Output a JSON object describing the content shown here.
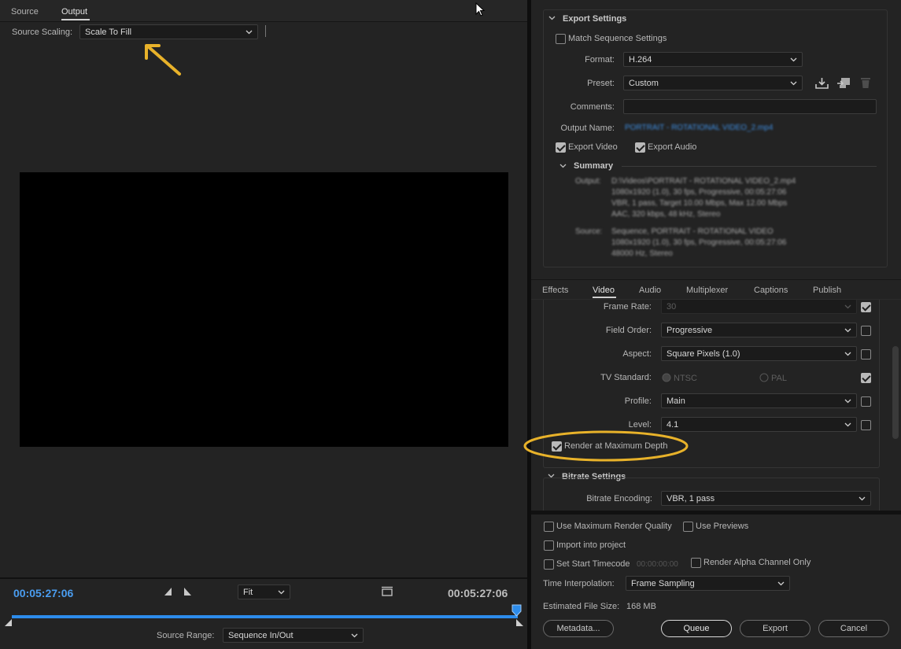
{
  "left": {
    "tabs": [
      {
        "label": "Source"
      },
      {
        "label": "Output"
      }
    ],
    "source_scaling_label": "Source Scaling:",
    "source_scaling_value": "Scale To Fill",
    "timecode_left": "00:05:27:06",
    "timecode_right": "00:05:27:06",
    "zoom_value": "Fit",
    "source_range_label": "Source Range:",
    "source_range_value": "Sequence In/Out"
  },
  "export_settings": {
    "header": "Export Settings",
    "match_sequence": "Match Sequence Settings",
    "format_label": "Format:",
    "format_value": "H.264",
    "preset_label": "Preset:",
    "preset_value": "Custom",
    "comments_label": "Comments:",
    "comments_value": "",
    "output_name_label": "Output Name:",
    "output_name_value": "PORTRAIT - ROTATIONAL VIDEO_2.mp4",
    "export_video": "Export Video",
    "export_audio": "Export Audio",
    "summary_header": "Summary",
    "summary_output_label": "Output:",
    "summary_output_lines": [
      "D:\\Videos\\PORTRAIT - ROTATIONAL VIDEO_2.mp4",
      "1080x1920 (1.0), 30 fps, Progressive, 00:05:27:06",
      "VBR, 1 pass, Target 10.00 Mbps, Max 12.00 Mbps",
      "AAC, 320 kbps, 48 kHz, Stereo"
    ],
    "summary_source_label": "Source:",
    "summary_source_lines": [
      "Sequence, PORTRAIT - ROTATIONAL VIDEO",
      "1080x1920 (1.0), 30 fps, Progressive, 00:05:27:06",
      "48000 Hz, Stereo"
    ]
  },
  "tabs": [
    {
      "label": "Effects"
    },
    {
      "label": "Video"
    },
    {
      "label": "Audio"
    },
    {
      "label": "Multiplexer"
    },
    {
      "label": "Captions"
    },
    {
      "label": "Publish"
    }
  ],
  "video": {
    "frame_rate_label": "Frame Rate:",
    "frame_rate_value": "30",
    "field_order_label": "Field Order:",
    "field_order_value": "Progressive",
    "aspect_label": "Aspect:",
    "aspect_value": "Square Pixels (1.0)",
    "tv_standard_label": "TV Standard:",
    "ntsc": "NTSC",
    "pal": "PAL",
    "profile_label": "Profile:",
    "profile_value": "Main",
    "level_label": "Level:",
    "level_value": "4.1",
    "render_max_depth": "Render at Maximum Depth",
    "bitrate_header": "Bitrate Settings",
    "bitrate_encoding_label": "Bitrate Encoding:",
    "bitrate_encoding_value": "VBR, 1 pass"
  },
  "bottom": {
    "use_max_render_quality": "Use Maximum Render Quality",
    "use_previews": "Use Previews",
    "import_into_project": "Import into project",
    "set_start_timecode": "Set Start Timecode",
    "start_timecode_value": "00:00:00:00",
    "render_alpha": "Render Alpha Channel Only",
    "time_interpolation_label": "Time Interpolation:",
    "time_interpolation_value": "Frame Sampling",
    "estimated_file_size": "Estimated File Size:",
    "estimated_file_size_value": "168 MB",
    "metadata_button": "Metadata...",
    "queue_button": "Queue",
    "export_button": "Export",
    "cancel_button": "Cancel"
  },
  "colors": {
    "accent_blue": "#2d8ceb",
    "annotation_yellow": "#e8b22a",
    "timecode_blue": "#4a9df0"
  }
}
